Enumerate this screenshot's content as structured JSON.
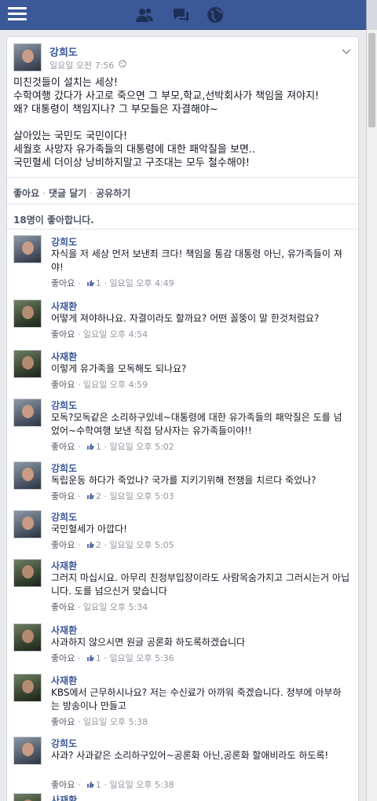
{
  "post": {
    "author": "강희도",
    "time": "일요일 오전 7:56",
    "lines": [
      "미친것들이 설치는 세상!",
      "수학여행 갔다가 사고로 죽으면 그 부모,학교,선박회사가 책임을 져야지!",
      "왜? 대통령이 책임지나? 그 부모들은 자결해야~",
      "",
      "살아있는 국민도 국민이다!",
      "세월호 사망자 유가족들의 대통령에 대한 패악질을 보면..",
      "국민혈세 더이상 낭비하지말고 구조대는 모두 철수해야!"
    ]
  },
  "actions": {
    "like": "좋아요",
    "comment": "댓글 달기",
    "share": "공유하기",
    "sep": "·"
  },
  "likes_summary": "18명이 좋아합니다.",
  "comments": [
    {
      "author": "강희도",
      "text": "자식을 저 세상 먼저 보낸죄 크다! 책임을 통감 대통령 아닌, 유가족들이 져야!",
      "like_label": "좋아요",
      "like_count": "1",
      "time": "일요일 오후 4:49"
    },
    {
      "author": "사재환",
      "text": "어떻게 져야하나요. 자결이라도 할까요? 어떤 꼴뚱이 말 한것처럼요?",
      "like_label": "좋아요",
      "like_count": "",
      "time": "일요일 오후 4:54"
    },
    {
      "author": "사재환",
      "text": "이렇게 유가족을 모독해도 되나요?",
      "like_label": "좋아요",
      "like_count": "",
      "time": "일요일 오후 4:59"
    },
    {
      "author": "강희도",
      "text": "모독?모독같은 소리하구있네~대통령에 대한 유가족들의 패악질은 도를 넘었어~수학여행 보낸 직접 당사자는 유가족들이야!!",
      "like_label": "좋아요",
      "like_count": "1",
      "time": "일요일 오후 5:02"
    },
    {
      "author": "강희도",
      "text": "독립운동 하다가 죽었나? 국가를 지키기위해 전쟁을 치르다 죽었나?",
      "like_label": "좋아요",
      "like_count": "2",
      "time": "일요일 오후 5:03"
    },
    {
      "author": "강희도",
      "text": "국민혈세가 아깝다!",
      "like_label": "좋아요",
      "like_count": "2",
      "time": "일요일 오후 5:05"
    },
    {
      "author": "사재환",
      "text": "그러지 마십시요. 아무리 친정부입장이라도 사람목숨가지고 그러시는거 아닙니다. 도를 넘으신거 맞습니다",
      "like_label": "좋아요",
      "like_count": "",
      "time": "일요일 오후 5:34"
    },
    {
      "author": "사재환",
      "text": "사과하지 않으시면 원글 공론화 하도록하겠습니다",
      "like_label": "좋아요",
      "like_count": "1",
      "time": "일요일 오후 5:36"
    },
    {
      "author": "사재환",
      "text": "KBS에서 근무하시나요? 저는 수신료가 아까워 죽겠습니다. 정부에 아부하는 방송이나 만들고",
      "like_label": "좋아요",
      "like_count": "",
      "time": "일요일 오후 5:38"
    },
    {
      "author": "강희도",
      "text": "사과? 사과같은 소리하구있어~공론화 아닌,공론화 할애비라도 하도록!",
      "like_label": "좋아요",
      "like_count": "1",
      "time": "일요일 오후 5:38"
    },
    {
      "author": "사재환",
      "text": "",
      "like_label": "",
      "like_count": "",
      "time": ""
    }
  ],
  "icons": {
    "menu": "menu-icon",
    "friends": "friend-requests-icon",
    "messages": "messages-icon",
    "notifications": "notifications-globe-icon",
    "like": "thumbs-up-icon"
  },
  "colors": {
    "brand": "#3b5998",
    "meta": "#9197a3",
    "link": "#3b5998"
  }
}
